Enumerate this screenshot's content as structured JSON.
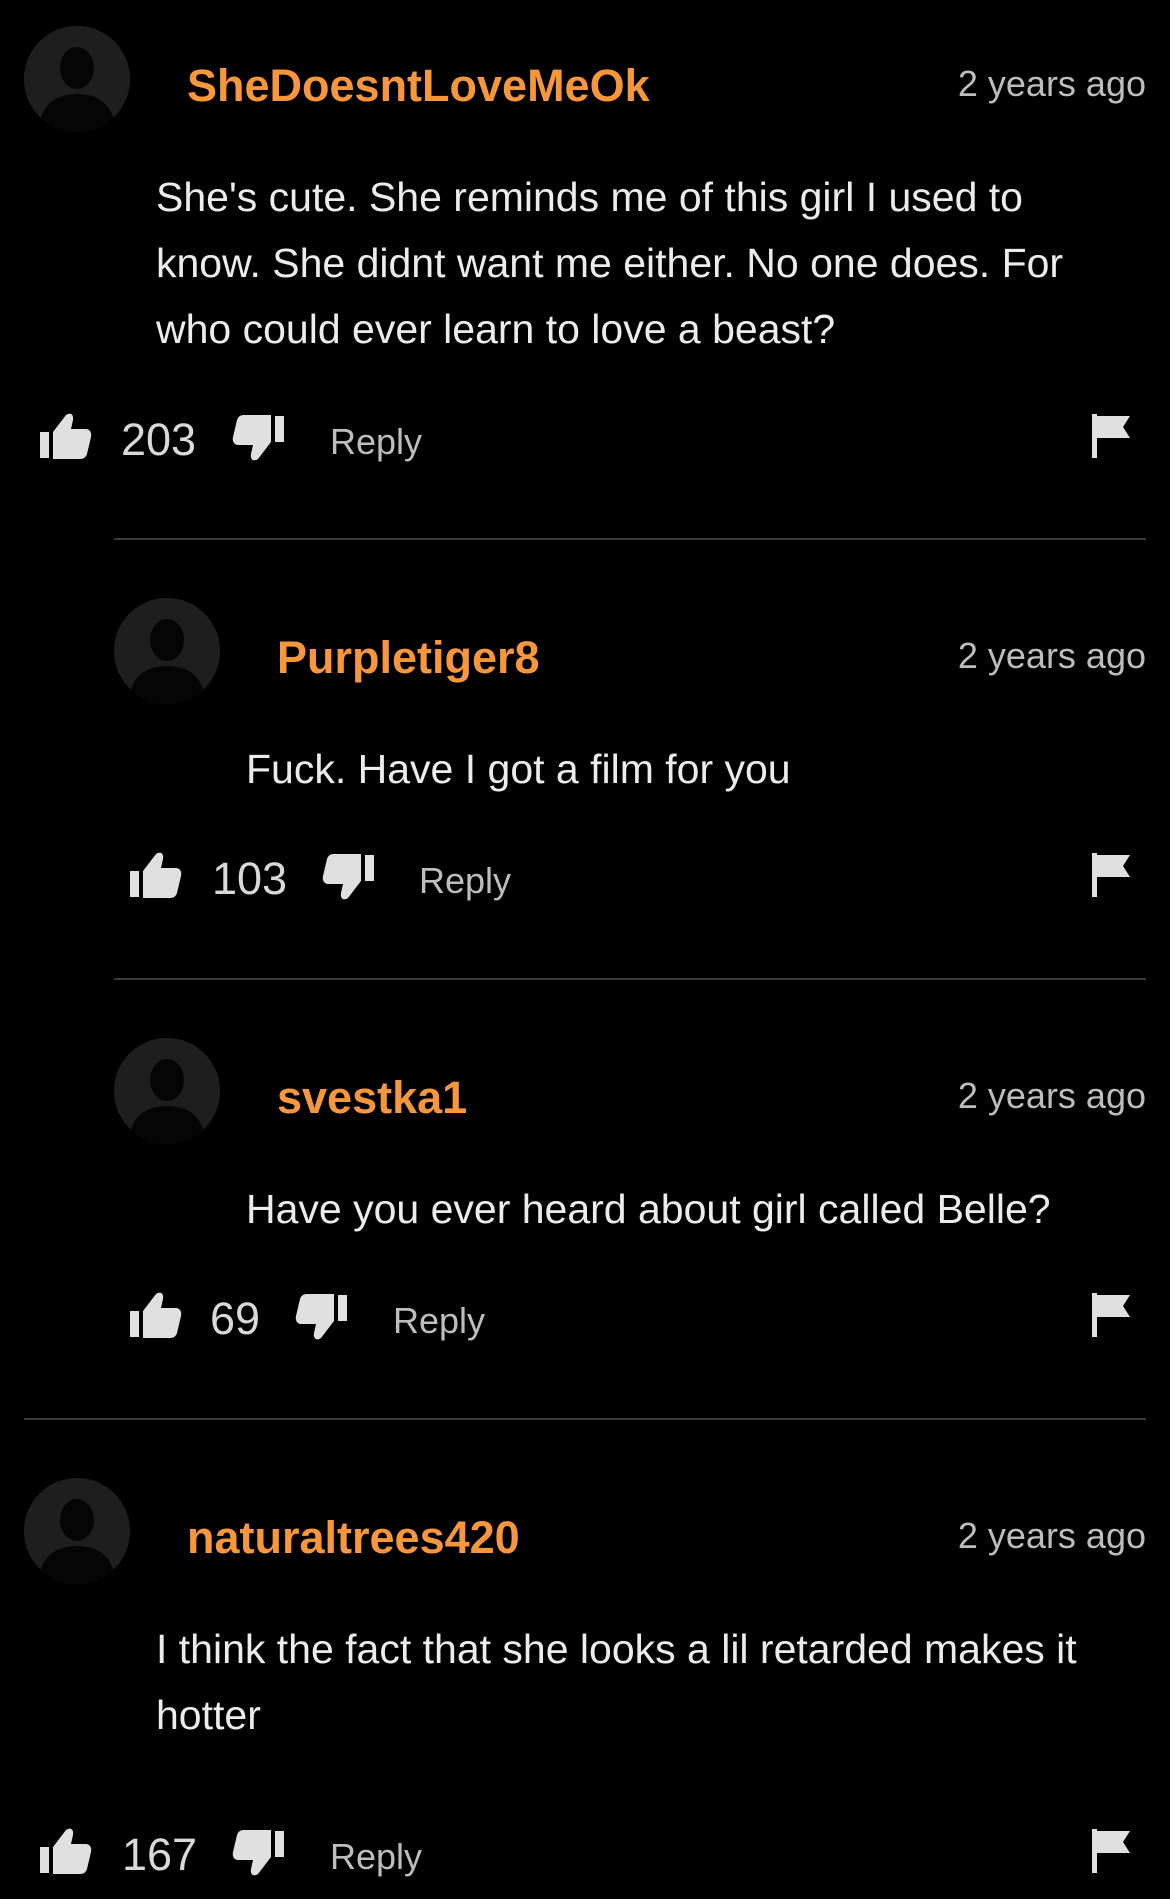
{
  "comments": [
    {
      "username": "SheDoesntLoveMeOk",
      "time": "2 years ago",
      "text": "She's cute. She reminds me of this girl I used to know. She didnt want me either. No one does. For who could ever learn to love a beast?",
      "likes": "203",
      "reply_label": "Reply"
    },
    {
      "username": "Purpletiger8",
      "time": "2 years ago",
      "text": "Fuck. Have I got a film for you",
      "likes": "103",
      "reply_label": "Reply"
    },
    {
      "username": "svestka1",
      "time": "2 years ago",
      "text": "Have you ever heard about girl called Belle?",
      "likes": "69",
      "reply_label": "Reply"
    },
    {
      "username": "naturaltrees420",
      "time": "2 years ago",
      "text": "I think the fact that she looks a lil retarded makes it hotter",
      "likes": "167",
      "reply_label": "Reply"
    }
  ],
  "colors": {
    "username": "#f7963a",
    "background": "#000000",
    "muted": "#bdbdbd"
  },
  "icons": {
    "avatar": "default-user-silhouette",
    "like": "thumbs-up",
    "dislike": "thumbs-down",
    "report": "flag"
  }
}
